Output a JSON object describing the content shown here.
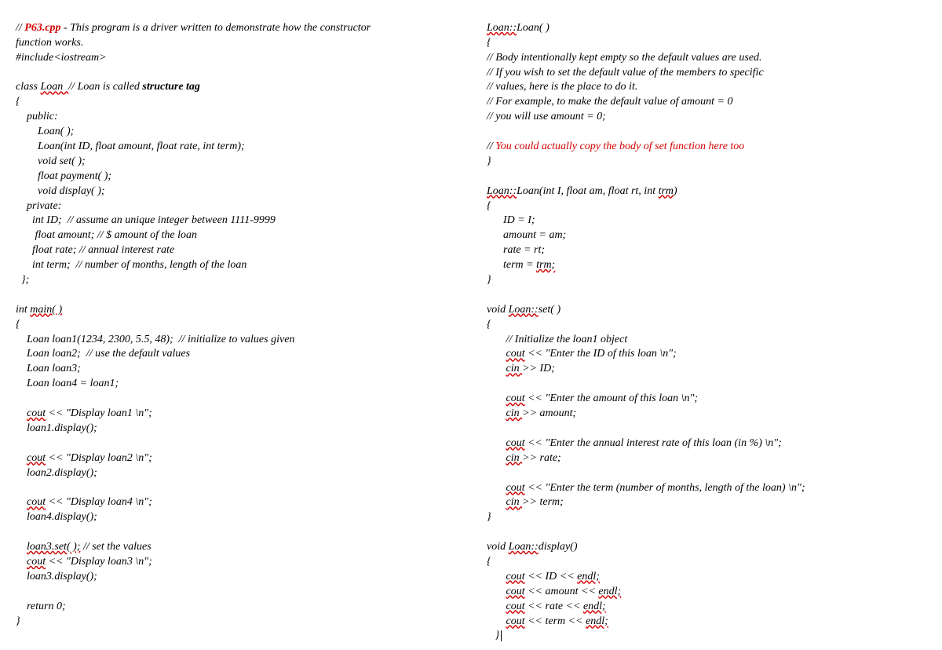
{
  "left": {
    "l1a": "// ",
    "l1b": "P63.cpp",
    "l1c": " - This program is a driver written to demonstrate how the constructor",
    "l2": "function works.",
    "l3": "#include<iostream>",
    "l4": "",
    "l5a": "class ",
    "l5b": "Loan  ",
    "l5c": "// Loan is called ",
    "l5d": "structure tag",
    "l6": "{",
    "l7": "    public:",
    "l8": "        Loan( );",
    "l9": "        Loan(int ID, float amount, float rate, int term);",
    "l10": "        void set( );",
    "l11": "        float payment( );",
    "l12": "        void display( );",
    "l13": "    private:",
    "l14": "      int ID;  // assume an unique integer between 1111-9999",
    "l15": "       float amount; // $ amount of the loan",
    "l16": "      float rate; // annual interest rate",
    "l17": "      int term;  // number of months, length of the loan",
    "l18": "  };",
    "l19": "",
    "l20a": "int ",
    "l20b": "main( )",
    "l21": "{",
    "l22": "    Loan loan1(1234, 2300, 5.5, 48);  // initialize to values given",
    "l23": "    Loan loan2;  // use the default values",
    "l24": "    Loan loan3;",
    "l25": "    Loan loan4 = loan1;",
    "l26": "",
    "l27a": "    ",
    "l27b": "cout",
    "l27c": " << \"Display loan1 \\n\";",
    "l28": "    loan1.display();",
    "l29": "",
    "l30a": "    ",
    "l30b": "cout",
    "l30c": " << \"Display loan2 \\n\";",
    "l31": "    loan2.display();",
    "l32": "",
    "l33a": "    ",
    "l33b": "cout",
    "l33c": " << \"Display loan4 \\n\";",
    "l34": "    loan4.display();",
    "l35": "",
    "l36a": "    ",
    "l36b": "loan3.set( );",
    "l36c": " // set the values",
    "l37a": "    ",
    "l37b": "cout",
    "l37c": " << \"Display loan3 \\n\";",
    "l38": "    loan3.display();",
    "l39": "",
    "l40": "    return 0;",
    "l41": "}"
  },
  "right": {
    "r1a": "Loan::",
    "r1b": "Loan( )",
    "r2": "{",
    "r3": "// Body intentionally kept empty so the default values are used.",
    "r4": "// If you wish to set the default value of the members to specific",
    "r5": "// values, here is the place to do it.",
    "r6": "// For example, to make the default value of amount = 0",
    "r7": "// you will use amount = 0;",
    "r8": "",
    "r9a": "// ",
    "r9b": "You could actually copy the body of set function here too",
    "r10": "}",
    "r11": "",
    "r12a": "Loan::",
    "r12b": "Loan(int I, float am, float rt, int ",
    "r12c": "trm",
    "r12d": ")",
    "r13": "{",
    "r14": "      ID = I;",
    "r15": "      amount = am;",
    "r16": "      rate = rt;",
    "r17a": "      term = ",
    "r17b": "trm;",
    "r18": "}",
    "r19": "",
    "r20a": "void ",
    "r20b": "Loan::",
    "r20c": "set( )",
    "r21": "{",
    "r22": "       // Initialize the loan1 object",
    "r23a": "       ",
    "r23b": "cout",
    "r23c": " << \"Enter the ID of this loan \\n\";",
    "r24a": "       ",
    "r24b": "cin ",
    "r24c": ">> ID;",
    "r25": "",
    "r26a": "       ",
    "r26b": "cout",
    "r26c": " << \"Enter the amount of this loan \\n\";",
    "r27a": "       ",
    "r27b": "cin ",
    "r27c": ">> amount;",
    "r28": "",
    "r29a": "       ",
    "r29b": "cout",
    "r29c": " << \"Enter the annual interest rate of this loan (in %) \\n\";",
    "r30a": "       ",
    "r30b": "cin ",
    "r30c": ">> rate;",
    "r31": "",
    "r32a": "       ",
    "r32b": "cout",
    "r32c": " << \"Enter the term (number of months, length of the loan) \\n\";",
    "r33a": "       ",
    "r33b": "cin ",
    "r33c": ">> term;",
    "r34": "}",
    "r35": "",
    "r36a": "void ",
    "r36b": "Loan::",
    "r36c": "display()",
    "r37": "{",
    "r38a": "       ",
    "r38b": "cout",
    "r38c": " << ID << ",
    "r38d": "endl;",
    "r39a": "       ",
    "r39b": "cout",
    "r39c": " << amount << ",
    "r39d": "endl;",
    "r40a": "       ",
    "r40b": "cout",
    "r40c": " << rate << ",
    "r40d": "endl;",
    "r41a": "       ",
    "r41b": "cout",
    "r41c": " << term << ",
    "r41d": "endl;",
    "r42": "   }"
  }
}
